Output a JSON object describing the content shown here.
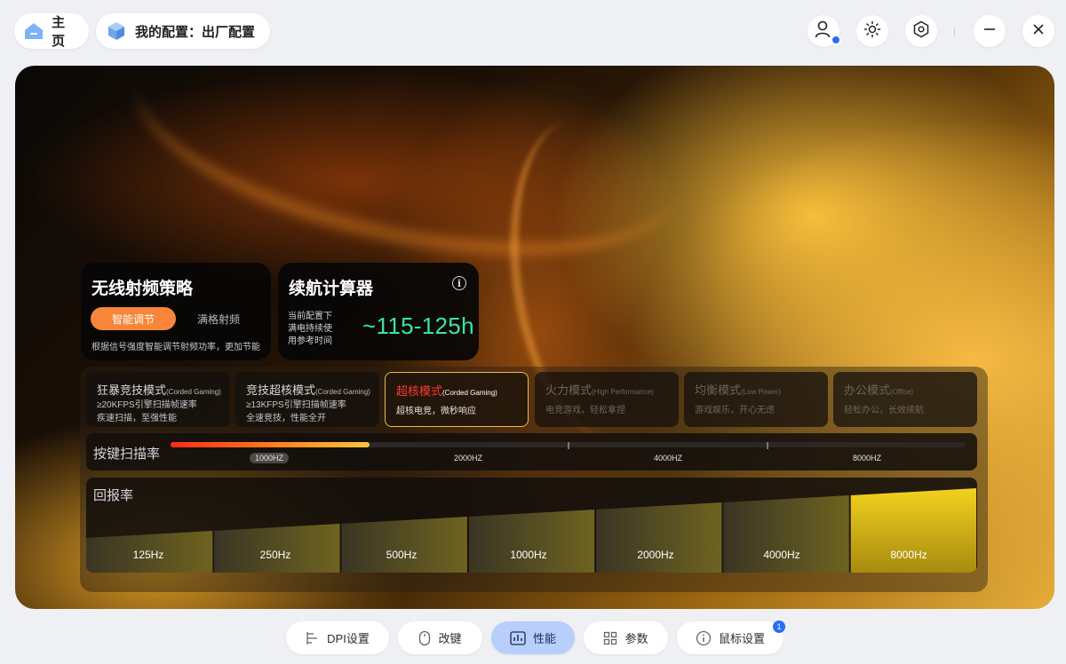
{
  "topbar": {
    "home_label": "主页",
    "profile_label": "我的配置：出厂配置",
    "icons": {
      "home": "home-icon",
      "profile": "cube-icon",
      "user": "user-icon",
      "brightness": "brightness-icon",
      "settings": "hexagon-settings-icon",
      "minimize": "minimize-icon",
      "close": "close-icon"
    }
  },
  "wireless": {
    "title": "无线射频策略",
    "options": [
      "智能调节",
      "满格射频"
    ],
    "selected": "智能调节",
    "description": "根据信号强度智能调节射频功率，更加节能"
  },
  "battery": {
    "title": "续航计算器",
    "lines": [
      "当前配置下",
      "满电持续使",
      "用参考时间"
    ],
    "value": "~115-125h",
    "info_icon": "info-icon"
  },
  "modes": [
    {
      "name": "狂暴竞技模式",
      "tag": "(Corded Gaming)",
      "lines": [
        "≥20KFPS引擎扫描帧速率",
        "疾速扫描，至强性能"
      ],
      "state": "normal"
    },
    {
      "name": "竞技超核模式",
      "tag": "(Corded Gaming)",
      "lines": [
        "≥13KFPS引擎扫描帧速率",
        "全速竞技，性能全开"
      ],
      "state": "normal"
    },
    {
      "name": "超核模式",
      "tag": "(Corded Gaming)",
      "lines": [
        "超核电竞，微秒响应"
      ],
      "state": "active"
    },
    {
      "name": "火力模式",
      "tag": "(High Performance)",
      "lines": [
        "电竞游戏，轻松拿捏"
      ],
      "state": "dim"
    },
    {
      "name": "均衡模式",
      "tag": "(Low Power)",
      "lines": [
        "游戏娱乐，开心无虑"
      ],
      "state": "dim"
    },
    {
      "name": "办公模式",
      "tag": "(Office)",
      "lines": [
        "轻松办公，长效续航"
      ],
      "state": "dim"
    }
  ],
  "scan_rate": {
    "label": "按键扫描率",
    "ticks": [
      "1000HZ",
      "2000HZ",
      "4000HZ",
      "8000HZ"
    ],
    "selected": "1000HZ",
    "fill_fraction": 0.25
  },
  "report_rate": {
    "label": "回报率",
    "options": [
      "125Hz",
      "250Hz",
      "500Hz",
      "1000Hz",
      "2000Hz",
      "4000Hz",
      "8000Hz"
    ],
    "selected": "8000Hz"
  },
  "bottom_nav": {
    "tabs": [
      {
        "label": "DPI设置",
        "icon": "dpi-icon"
      },
      {
        "label": "改键",
        "icon": "mouse-icon"
      },
      {
        "label": "性能",
        "icon": "performance-icon"
      },
      {
        "label": "参数",
        "icon": "grid-icon"
      },
      {
        "label": "鼠标设置",
        "icon": "info-icon"
      }
    ],
    "active": "性能",
    "notification_count": "1"
  },
  "colors": {
    "accent_orange": "#f7863a",
    "battery_green": "#35e6a6",
    "active_mode_red": "#ff3a2e",
    "active_mode_border": "#f0b94a",
    "active_tab_bg": "#b8cffd",
    "notification_blue": "#2c6cf6"
  }
}
